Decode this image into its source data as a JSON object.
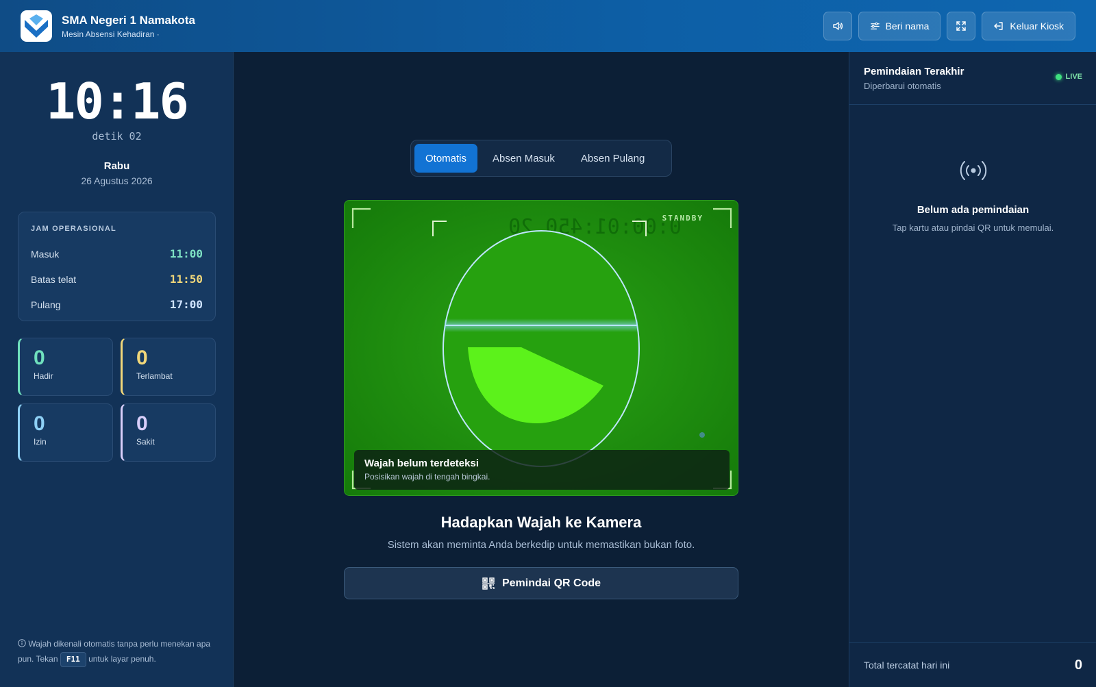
{
  "header": {
    "school_name": "SMA Negeri 1 Namakota",
    "subtitle": "Mesin Absensi Kehadiran ·",
    "sound_icon": "speaker-icon",
    "rename_label": "Beri nama",
    "fullscreen_icon": "expand-icon",
    "exit_label": "Keluar Kiosk"
  },
  "clock": {
    "time": "10:16",
    "seconds": "detik 02",
    "day": "Rabu",
    "date": "26 Agustus 2026"
  },
  "operational": {
    "title": "JAM OPERASIONAL",
    "rows": [
      {
        "label": "Masuk",
        "value": "11:00",
        "color": "#7ee2c4"
      },
      {
        "label": "Batas telat",
        "value": "11:50",
        "color": "#f1d77a"
      },
      {
        "label": "Pulang",
        "value": "17:00",
        "color": "#cfe3ff"
      }
    ]
  },
  "stats": [
    {
      "label": "Hadir",
      "value": "0",
      "color": "#6fe0bd"
    },
    {
      "label": "Terlambat",
      "value": "0",
      "color": "#f1d77a"
    },
    {
      "label": "Izin",
      "value": "0",
      "color": "#8ed0f5"
    },
    {
      "label": "Sakit",
      "value": "0",
      "color": "#d9cffb"
    }
  ],
  "footnote": {
    "text_before": "Wajah dikenali otomatis tanpa perlu menekan apa pun. Tekan",
    "key": "F11",
    "text_after": "untuk layar penuh."
  },
  "modes": {
    "items": [
      "Otomatis",
      "Absen Masuk",
      "Absen Pulang"
    ],
    "active": "Otomatis"
  },
  "camera": {
    "status_tag": "STANDBY",
    "mirrored_timestamp": "0:00:01:450 20",
    "hint_title": "Wajah belum terdeteksi",
    "hint_sub": "Posisikan wajah di tengah bingkai."
  },
  "instruction": {
    "title": "Hadapkan Wajah ke Kamera",
    "subtitle": "Sistem akan meminta Anda berkedip untuk memastikan bukan foto."
  },
  "qr_button": {
    "label": "Pemindai QR Code",
    "icon": "qr-code-icon"
  },
  "recent": {
    "title": "Pemindaian Terakhir",
    "subtitle": "Diperbarui otomatis",
    "live_label": "LIVE",
    "empty_icon": "broadcast-icon",
    "empty_title": "Belum ada pemindaian",
    "empty_sub": "Tap kartu atau pindai QR untuk memulai.",
    "total_label": "Total tercatat hari ini",
    "total_value": "0"
  }
}
